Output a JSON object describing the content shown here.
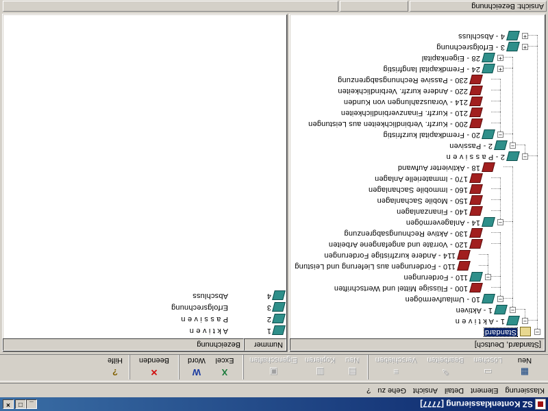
{
  "window": {
    "title": "SZ Kontenklassierung [7777]"
  },
  "menu": [
    "Klassierung",
    "Element",
    "Detail",
    "Ansicht",
    "Gehe zu",
    "?"
  ],
  "toolbar": {
    "neu": "Neu",
    "loeschen": "Löschen",
    "bearbeiten": "Bearbeiten",
    "verschieben": "Verschieben",
    "neu2": "Neu",
    "kopieren": "Kopieren",
    "eigenschaften": "Eigenschaften",
    "excel": "Excel",
    "word": "Word",
    "beenden": "Beenden",
    "hilfe": "Hilfe"
  },
  "tree": {
    "header": "[Standard, Deutsch]",
    "nodes": [
      {
        "id": "n0",
        "text": "Standard",
        "icon": "folder",
        "expanded": true,
        "selected": true
      },
      {
        "id": "n1",
        "text": "1 - A k t i v e n",
        "icon": "teal-book",
        "expanded": true
      },
      {
        "id": "n2",
        "text": "1 - Aktiven",
        "icon": "teal-book",
        "expanded": true
      },
      {
        "id": "n3",
        "text": "10 - Umlaufvermögen",
        "icon": "teal-book",
        "expanded": true
      },
      {
        "id": "n4",
        "text": "100 - Flüssige Mittel und Wertschriften",
        "icon": "red-book"
      },
      {
        "id": "n5",
        "text": "110 - Forderungen",
        "icon": "teal-book",
        "expanded": true
      },
      {
        "id": "n6",
        "text": "110 - Forderungen aus Lieferung und Leistung",
        "icon": "red-book"
      },
      {
        "id": "n7",
        "text": "114 - Andere kurzfristige Forderungen",
        "icon": "red-book"
      },
      {
        "id": "n8",
        "text": "120 - Vorräte und angefangene Arbeiten",
        "icon": "red-book"
      },
      {
        "id": "n9",
        "text": "130 - Aktive Rechnungsabgrenzung",
        "icon": "red-book"
      },
      {
        "id": "n10",
        "text": "14 - Anlagevermögen",
        "icon": "teal-book",
        "expanded": true
      },
      {
        "id": "n11",
        "text": "140 - Finanzanlagen",
        "icon": "red-book"
      },
      {
        "id": "n12",
        "text": "150 - Mobile Sachanlagen",
        "icon": "red-book"
      },
      {
        "id": "n13",
        "text": "160 - Immobile Sachanlagen",
        "icon": "red-book"
      },
      {
        "id": "n14",
        "text": "170 - Immaterielle Anlagen",
        "icon": "red-book"
      },
      {
        "id": "n15",
        "text": "18 - Aktivierter Aufwand",
        "icon": "red-book"
      },
      {
        "id": "n16",
        "text": "2 - P a s s i v e n",
        "icon": "teal-book",
        "expanded": true
      },
      {
        "id": "n17",
        "text": "2 - Passiven",
        "icon": "teal-book",
        "expanded": true
      },
      {
        "id": "n18",
        "text": "20 - Fremdkapital kurzfristig",
        "icon": "teal-book",
        "expanded": true
      },
      {
        "id": "n19",
        "text": "200 - Kurzfr. Verbindlichkeiten aus Leistungen",
        "icon": "red-book"
      },
      {
        "id": "n20",
        "text": "210 - Kurzfr. Finanzverbindlichkeiten",
        "icon": "red-book"
      },
      {
        "id": "n21",
        "text": "214 - Vorauszahlungen von Kunden",
        "icon": "red-book"
      },
      {
        "id": "n22",
        "text": "220 - Andere kurzfr. Verbindlichkeiten",
        "icon": "red-book"
      },
      {
        "id": "n23",
        "text": "230 - Passive Rechnungsabgrenzung",
        "icon": "red-book"
      },
      {
        "id": "n24",
        "text": "24 - Fremdkapital langfristig",
        "icon": "teal-book",
        "expanded": false
      },
      {
        "id": "n25",
        "text": "28 - Eigenkapital",
        "icon": "teal-book",
        "expanded": false
      },
      {
        "id": "n26",
        "text": "3 - Erfolgsrechnung",
        "icon": "teal-book",
        "expanded": false
      },
      {
        "id": "n27",
        "text": "4 - Abschluss",
        "icon": "teal-book",
        "expanded": false
      }
    ]
  },
  "list": {
    "columns": [
      "Nummer",
      "Bezeichnung"
    ],
    "rows": [
      {
        "nummer": "1",
        "bezeichnung": "A k t i v e n"
      },
      {
        "nummer": "2",
        "bezeichnung": "P a s s i v e n"
      },
      {
        "nummer": "3",
        "bezeichnung": "Erfolgsrechnung"
      },
      {
        "nummer": "4",
        "bezeichnung": "Abschluss"
      }
    ]
  },
  "statusbar": {
    "view": "Ansicht: Bezeichnung"
  }
}
